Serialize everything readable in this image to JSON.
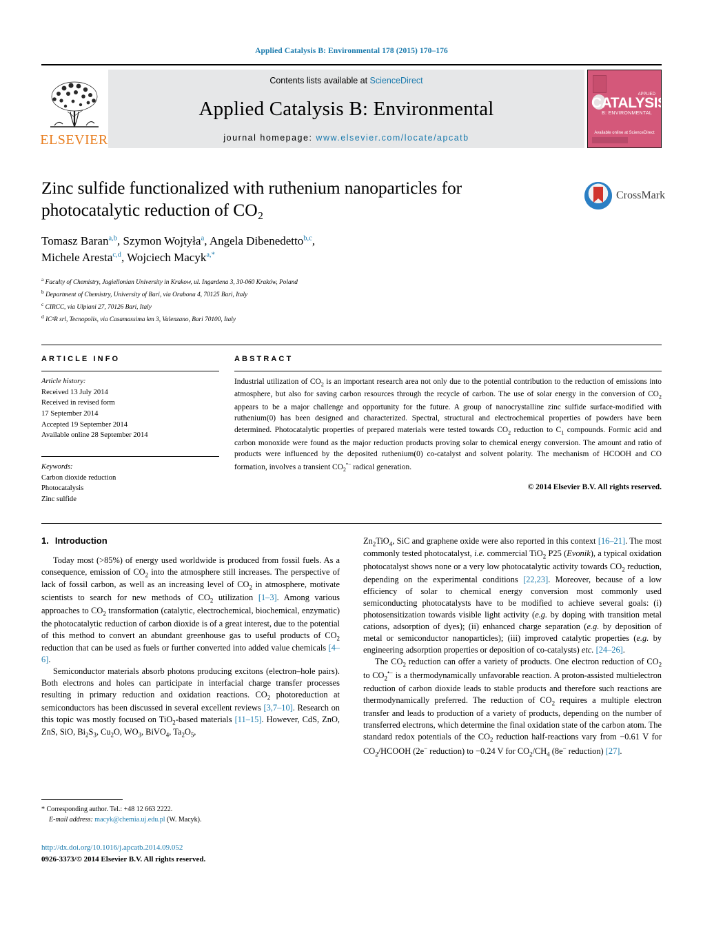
{
  "running_head": "Applied Catalysis B: Environmental 178 (2015) 170–176",
  "header": {
    "contents_prefix": "Contents lists available at ",
    "sciencedirect": "ScienceDirect",
    "journal_title": "Applied Catalysis B: Environmental",
    "homepage_label": "journal homepage: ",
    "homepage_url": "www.elsevier.com/locate/apcatb",
    "elsevier_word": "ELSEVIER",
    "accent_link_color": "#1a7aad",
    "elsevier_orange": "#E87D1E",
    "cover": {
      "main_word": "CATALYSIS",
      "sub_word": "B: ENVIRONMENTAL",
      "applied": "APPLIED",
      "bottom": "Available online at ScienceDirect",
      "bg_color": "#d4587a"
    }
  },
  "crossmark": {
    "label": "CrossMark"
  },
  "title": "Zinc sulfide functionalized with ruthenium nanoparticles for photocatalytic reduction of CO₂",
  "authors_html": "Tomasz Baran<sup>a,b</sup>, Szymon Wojtyła<sup>a</sup>, Angela Dibenedetto<sup>b,c</sup>,<br>Michele Aresta<sup>c,d</sup>, Wojciech Macyk<sup>a,*</sup>",
  "affiliations": [
    {
      "marker": "a",
      "text": "Faculty of Chemistry, Jagiellonian University in Krakow, ul. Ingardena 3, 30-060 Kraków, Poland"
    },
    {
      "marker": "b",
      "text": "Department of Chemistry, University of Bari, via Orabona 4, 70125 Bari, Italy"
    },
    {
      "marker": "c",
      "text": "CIRCC, via Ulpiani 27, 70126 Bari, Italy"
    },
    {
      "marker": "d",
      "text": "IC²R srl, Tecnopolis, via Casamassima km 3, Valenzano, Bari 70100, Italy"
    }
  ],
  "article_info": {
    "heading": "ARTICLE INFO",
    "history_label": "Article history:",
    "history": [
      "Received 13 July 2014",
      "Received in revised form",
      "17 September 2014",
      "Accepted 19 September 2014",
      "Available online 28 September 2014"
    ],
    "keywords_label": "Keywords:",
    "keywords": [
      "Carbon dioxide reduction",
      "Photocatalysis",
      "Zinc sulfide"
    ]
  },
  "abstract": {
    "heading": "ABSTRACT",
    "text_html": "Industrial utilization of CO<sub>2</sub> is an important research area not only due to the potential contribution to the reduction of emissions into atmosphere, but also for saving carbon resources through the recycle of carbon. The use of solar energy in the conversion of CO<sub>2</sub> appears to be a major challenge and opportunity for the future. A group of nanocrystalline zinc sulfide surface-modified with ruthenium(0) has been designed and characterized. Spectral, structural and electrochemical properties of powders have been determined. Photocatalytic properties of prepared materials were tested towards CO<sub>2</sub> reduction to C<sub>1</sub> compounds. Formic acid and carbon monoxide were found as the major reduction products proving solar to chemical energy conversion. The amount and ratio of products were influenced by the deposited ruthenium(0) co-catalyst and solvent polarity. The mechanism of HCOOH and CO formation, involves a transient CO<sub>2</sub><sup>•−</sup> radical generation.",
    "copyright": "© 2014 Elsevier B.V. All rights reserved."
  },
  "body": {
    "section_number": "1.",
    "section_title": "Introduction",
    "left_paragraphs_html": [
      "Today most (>85%) of energy used worldwide is produced from fossil fuels. As a consequence, emission of CO<sub>2</sub> into the atmosphere still increases. The perspective of lack of fossil carbon, as well as an increasing level of CO<sub>2</sub> in atmosphere, motivate scientists to search for new methods of CO<sub>2</sub> utilization <span class=\"ref\">[1–3]</span>. Among various approaches to CO<sub>2</sub> transformation (catalytic, electrochemical, biochemical, enzymatic) the photocatalytic reduction of carbon dioxide is of a great interest, due to the potential of this method to convert an abundant greenhouse gas to useful products of CO<sub>2</sub> reduction that can be used as fuels or further converted into added value chemicals <span class=\"ref\">[4–6]</span>.",
      "Semiconductor materials absorb photons producing excitons (electron–hole pairs). Both electrons and holes can participate in interfacial charge transfer processes resulting in primary reduction and oxidation reactions. CO<sub>2</sub> photoreduction at semiconductors has been discussed in several excellent reviews <span class=\"ref\">[3,7–10]</span>. Research on this topic was mostly focused on TiO<sub>2</sub>-based materials <span class=\"ref\">[11–15]</span>. However, CdS, ZnO, ZnS, SiO, Bi<sub>2</sub>S<sub>3</sub>, Cu<sub>2</sub>O, WO<sub>3</sub>, BiVO<sub>4</sub>, Ta<sub>2</sub>O<sub>5</sub>,"
    ],
    "right_paragraphs_html": [
      "Zn<sub>2</sub>TiO<sub>4</sub>, SiC and graphene oxide were also reported in this context <span class=\"ref\">[16–21]</span>. The most commonly tested photocatalyst, <i>i.e.</i> commercial TiO<sub>2</sub> P25 (<i>Evonik</i>), a typical oxidation photocatalyst shows none or a very low photocatalytic activity towards CO<sub>2</sub> reduction, depending on the experimental conditions <span class=\"ref\">[22,23]</span>. Moreover, because of a low efficiency of solar to chemical energy conversion most commonly used semiconducting photocatalysts have to be modified to achieve several goals: (i) photosensitization towards visible light activity (<i>e.g.</i> by doping with transition metal cations, adsorption of dyes); (ii) enhanced charge separation (<i>e.g.</i> by deposition of metal or semiconductor nanoparticles); (iii) improved catalytic properties (<i>e.g.</i> by engineering adsorption properties or deposition of co-catalysts) <i>etc.</i> <span class=\"ref\">[24–26]</span>.",
      "The CO<sub>2</sub> reduction can offer a variety of products. One electron reduction of CO<sub>2</sub> to CO<sub>2</sub><sup>•−</sup> is a thermodynamically unfavorable reaction. A proton-assisted multielectron reduction of carbon dioxide leads to stable products and therefore such reactions are thermodynamically preferred. The reduction of CO<sub>2</sub> requires a multiple electron transfer and leads to production of a variety of products, depending on the number of transferred electrons, which determine the final oxidation state of the carbon atom. The standard redox potentials of the CO<sub>2</sub> reduction half-reactions vary from −0.61 V for CO<sub>2</sub>/HCOOH (2e<sup>−</sup> reduction) to −0.24 V for CO<sub>2</sub>/CH<sub>4</sub> (8e<sup>−</sup> reduction) <span class=\"ref\">[27]</span>."
    ]
  },
  "footnote": {
    "corresponding_html": "* Corresponding author. Tel.: +48 12 663 2222.",
    "email_html": "<i>E-mail address:</i> <span class=\"email-link\">macyk@chemia.uj.edu.pl</span> (W. Macyk)."
  },
  "footer": {
    "doi": "http://dx.doi.org/10.1016/j.apcatb.2014.09.052",
    "issn_line": "0926-3373/© 2014 Elsevier B.V. All rights reserved."
  }
}
